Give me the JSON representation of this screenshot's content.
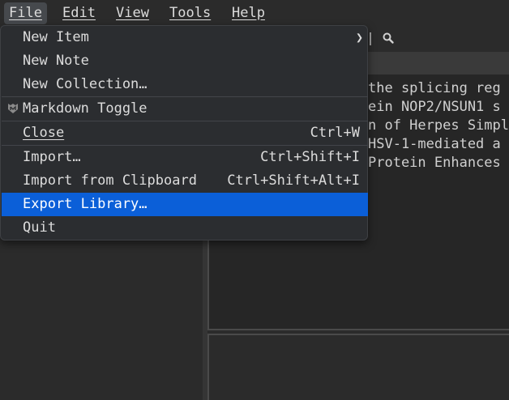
{
  "menubar": {
    "file": "File",
    "edit": "Edit",
    "view": "View",
    "tools": "Tools",
    "help": "Help"
  },
  "file_menu": {
    "items": [
      {
        "label": "New Item",
        "shortcut": "",
        "submenu": true
      },
      {
        "label": "New Note",
        "shortcut": ""
      },
      {
        "label": "New Collection…",
        "shortcut": ""
      },
      {
        "label": "Markdown Toggle",
        "shortcut": "",
        "icon": "markdown-icon"
      },
      {
        "label": "Close",
        "shortcut": "Ctrl+W"
      },
      {
        "label": "Import…",
        "shortcut": "Ctrl+Shift+I"
      },
      {
        "label": "Import from Clipboard",
        "shortcut": "Ctrl+Shift+Alt+I"
      },
      {
        "label": "Export Library…",
        "shortcut": "",
        "selected": true
      },
      {
        "label": "Quit",
        "shortcut": ""
      }
    ]
  },
  "library_list": {
    "lines": [
      "the splicing reg",
      "ein NOP2/NSUN1 s",
      "n of Herpes Simpl",
      "HSV-1-mediated a",
      "Protein Enhances"
    ]
  },
  "colors": {
    "background": "#2b2b2b",
    "menu_background": "#2b2d30",
    "selection": "#0b5fd8",
    "text": "#dcdcdc"
  }
}
